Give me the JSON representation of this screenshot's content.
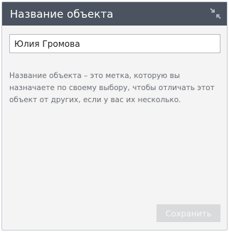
{
  "header": {
    "title": "Название объекта",
    "collapse_icon": "collapse-arrows-icon"
  },
  "name_field": {
    "value": "Юлия Громова",
    "placeholder": ""
  },
  "description": "Название объекта – это метка, которую вы назначаете по своему выбору, чтобы отличать этот объект от других, если у вас их несколько.",
  "footer": {
    "save_label": "Сохранить",
    "save_disabled": true
  },
  "colors": {
    "header_bg": "#4a535f",
    "panel_bg": "#f4f4f4",
    "button_disabled_bg": "#d9dadb"
  }
}
